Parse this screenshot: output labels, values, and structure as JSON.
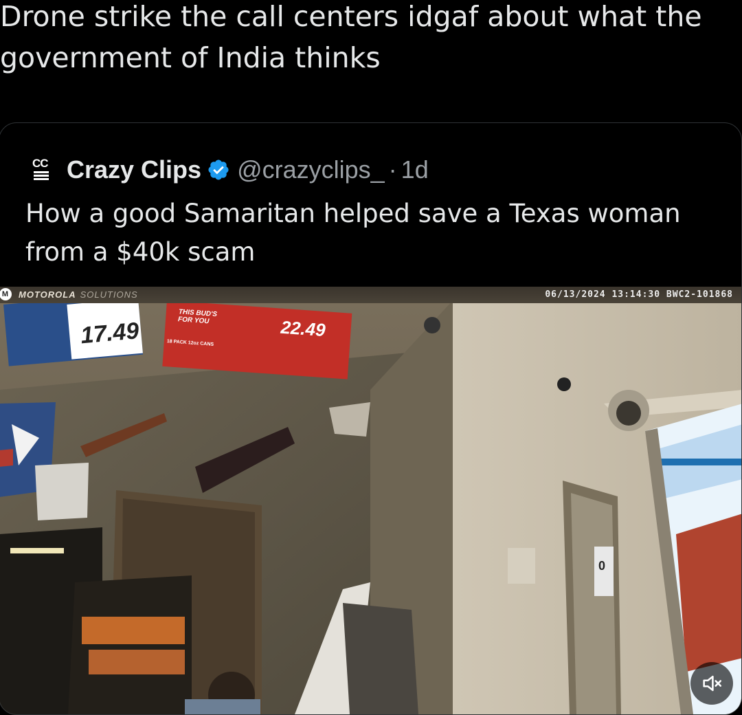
{
  "post": {
    "text": "Drone strike the call centers idgaf about what the government of India thinks"
  },
  "quote": {
    "avatar_text": "CC",
    "display_name": "Crazy Clips",
    "handle": "@crazyclips_",
    "separator": "·",
    "time": "1d",
    "text": "How a good Samaritan helped save a Texas woman from a $40k scam",
    "verified_color": "#1d9bf0"
  },
  "video": {
    "osd_logo": "M",
    "osd_brand": "MOTOROLA",
    "osd_brand_suffix": "SOLUTIONS",
    "osd_timestamp": "06/13/2024 13:14:30 BWC2-101868",
    "sign_left_price": "17.49",
    "sign_middle_text": "THIS BUD'S FOR YOU",
    "sign_middle_sub": "18 PACK 12oz CANS",
    "sign_middle_price": "22.49",
    "door_sign": "0",
    "mute_icon": "speaker-muted-icon"
  }
}
